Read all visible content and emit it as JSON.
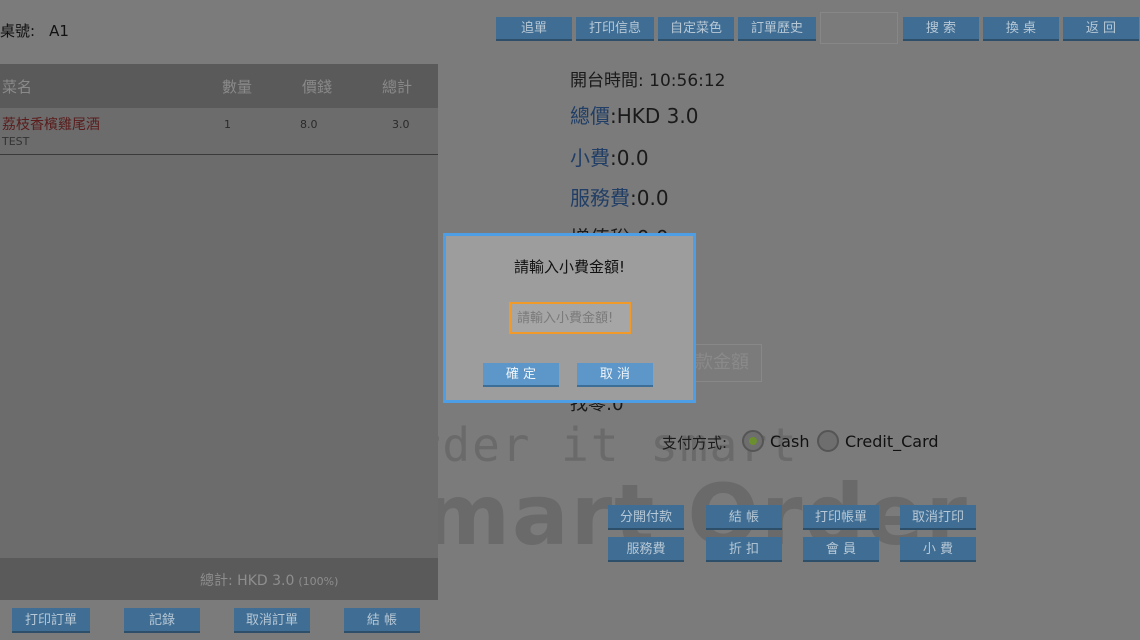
{
  "header": {
    "table_label": "桌號:",
    "table_value": "A1",
    "buttons": [
      "追單",
      "打印信息",
      "自定菜色",
      "訂單歷史"
    ],
    "search_placeholder": "",
    "search_label": "搜 索",
    "change_table_label": "換 桌",
    "back_label": "返 回"
  },
  "order": {
    "columns": [
      "菜名",
      "數量",
      "價錢",
      "總計"
    ],
    "items": [
      {
        "name": "荔枝香檳雞尾酒",
        "note": "TEST",
        "qty": "1",
        "price": "8.0",
        "total": "3.0"
      }
    ],
    "total_label": "總計:",
    "total_value": "HKD 3.0",
    "total_pct": "(100%)",
    "buttons": [
      "打印訂單",
      "記錄",
      "取消訂單",
      "結 帳"
    ]
  },
  "info": {
    "open_time_label": "開台時間:",
    "open_time": "10:56:12",
    "total_label": "總價",
    "total_value": ":HKD 3.0",
    "tip_label": "小費",
    "tip_value": ":0.0",
    "service_label": "服務費",
    "service_value": ":0.0",
    "vat_partial": "增值稅:0.0",
    "partial_amount": "款金額",
    "change_partial": "找零:0"
  },
  "payment": {
    "label": "支付方式:",
    "options": [
      {
        "label": "Cash",
        "selected": true
      },
      {
        "label": "Credit_Card",
        "selected": false
      }
    ]
  },
  "actions": {
    "row1": [
      "分開付款",
      "結 帳",
      "打印帳單",
      "取消打印"
    ],
    "row2": [
      "服務費",
      "折 扣",
      "會 員",
      "小 費"
    ]
  },
  "watermark": {
    "line1": "Order it smart",
    "line2": "Smart Order"
  },
  "dialog": {
    "title": "請輸入小費金額!",
    "input_value": "",
    "input_placeholder": "請輸入小費金額!",
    "ok_label": "確 定",
    "cancel_label": "取 消"
  },
  "colors": {
    "button_bg": "#3f6d93",
    "dialog_border": "#4e9ee6",
    "input_border": "#f29a29",
    "dialog_button_bg": "#5d97c9"
  }
}
